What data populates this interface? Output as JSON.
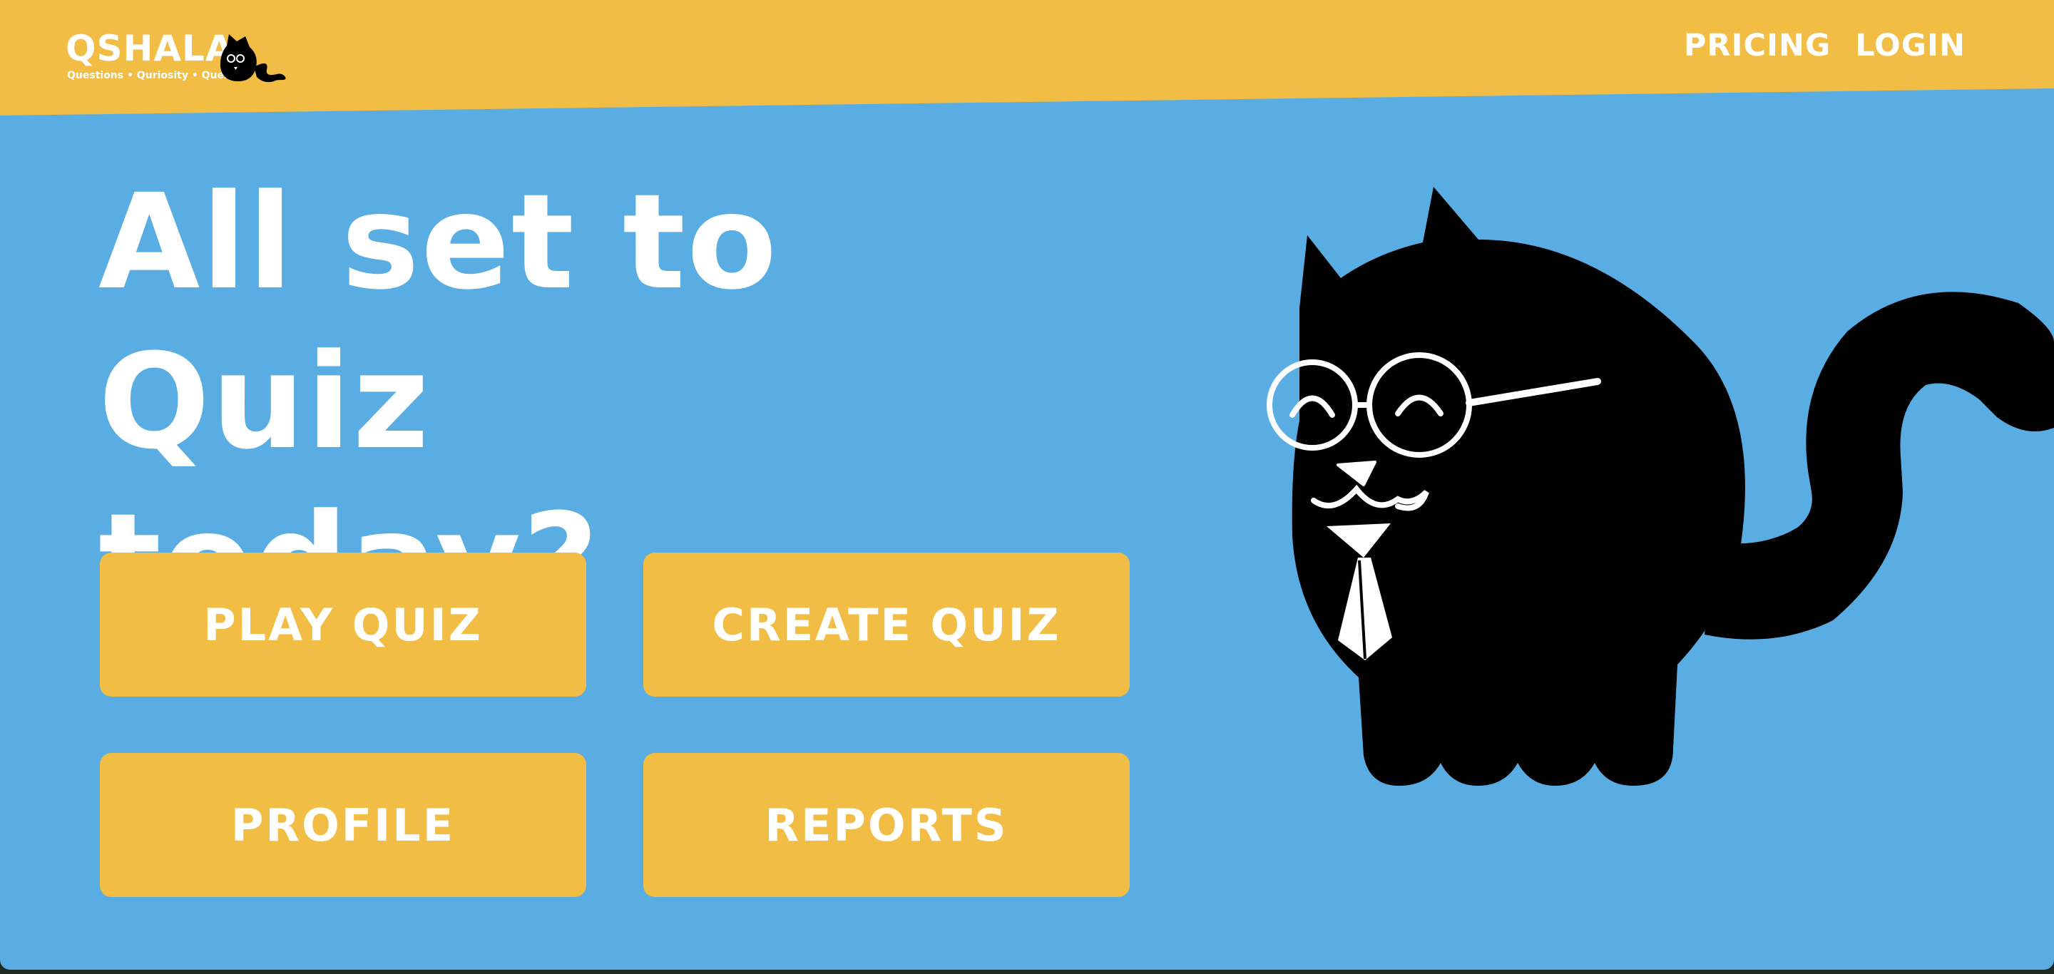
{
  "header": {
    "logo_word": "QSHALA",
    "logo_tagline": "Questions • Quriosity • Quests",
    "nav": {
      "pricing": "PRICING",
      "login": "LOGIN"
    }
  },
  "hero": {
    "headline_line1": "All set to Quiz",
    "headline_line2": "today?"
  },
  "actions": {
    "play_quiz": "PLAY QUIZ",
    "create_quiz": "CREATE QUIZ",
    "profile": "PROFILE",
    "reports": "REPORTS"
  },
  "colors": {
    "background": "#5aade2",
    "header": "#f2bd44",
    "button": "#f2bd44",
    "text": "#ffffff",
    "mascot": "#000000"
  },
  "icons": {
    "logo_mascot": "cat-logo-icon",
    "hero_mascot": "cat-with-glasses-and-tie-illustration"
  }
}
